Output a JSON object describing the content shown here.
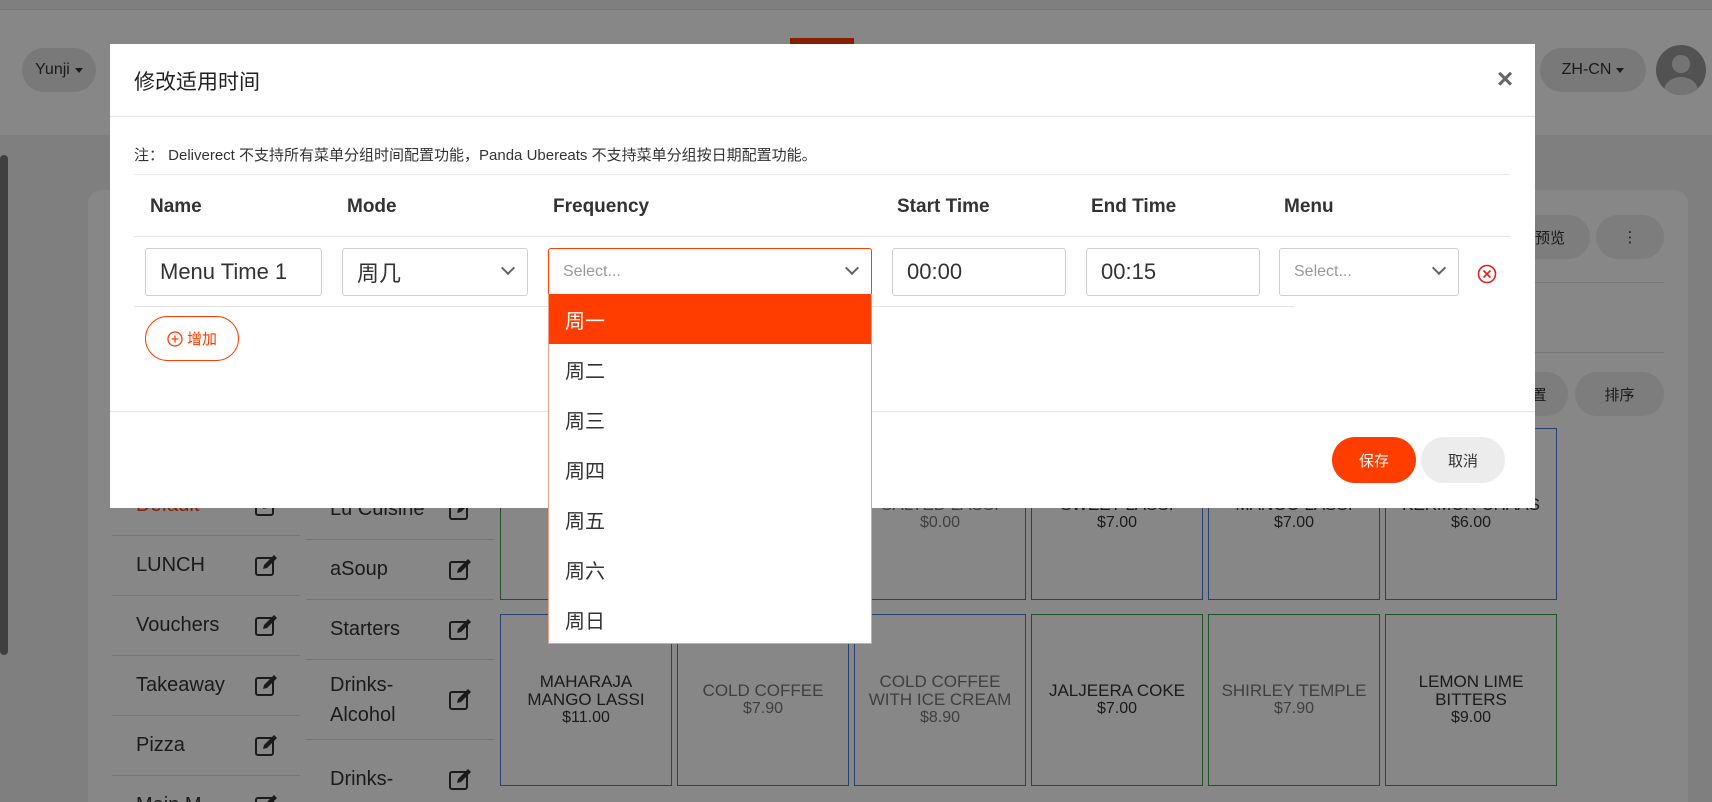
{
  "header": {
    "store_selector": "Yunji",
    "language_selector": "ZH-CN"
  },
  "toolbar": {
    "preview_label": "预览",
    "more_label": "⋮",
    "settings_label": "置",
    "sort_label": "排序"
  },
  "categories": [
    "Default",
    "LUNCH",
    "Vouchers",
    "Takeaway",
    "Pizza",
    "Main M"
  ],
  "subcategories": [
    "Lu Cuisine",
    "aSoup",
    "Starters",
    "Drinks-Alcohol",
    "Drinks-"
  ],
  "products_row1": [
    {
      "name": "",
      "price": ""
    },
    {
      "name": "",
      "price": ""
    },
    {
      "name": "SALTED LASSI",
      "price": "$0.00"
    },
    {
      "name": "SWEET LASSI",
      "price": "$7.00"
    },
    {
      "name": "MANGO LASSI",
      "price": "$7.00"
    },
    {
      "name": "KERMOR CHAAS",
      "price": "$6.00"
    }
  ],
  "products_row2": [
    {
      "name": "MAHARAJA MANGO LASSI",
      "price": "$11.00"
    },
    {
      "name": "COLD COFFEE",
      "price": "$7.90"
    },
    {
      "name": "COLD COFFEE WITH ICE CREAM",
      "price": "$8.90"
    },
    {
      "name": "JALJEERA COKE",
      "price": "$7.00"
    },
    {
      "name": "SHIRLEY TEMPLE",
      "price": "$7.90"
    },
    {
      "name": "LEMON LIME BITTERS",
      "price": "$9.00"
    }
  ],
  "modal": {
    "title": "修改适用时间",
    "close_label": "×",
    "note": "注： Deliverect 不支持所有菜单分组时间配置功能，Panda Ubereats 不支持菜单分组按日期配置功能。",
    "columns": [
      "Name",
      "Mode",
      "Frequency",
      "Start Time",
      "End Time",
      "Menu"
    ],
    "row": {
      "name": "Menu Time 1",
      "mode": "周几",
      "frequency_placeholder": "Select...",
      "start_time": "00:00",
      "end_time": "00:15",
      "menu_placeholder": "Select..."
    },
    "add_label": "增加",
    "save_label": "保存",
    "cancel_label": "取消"
  },
  "frequency_options": [
    "周一",
    "周二",
    "周三",
    "周四",
    "周五",
    "周六",
    "周日"
  ],
  "frequency_highlighted": "周一",
  "colors": {
    "accent": "#ff3d00",
    "tile_border_blue": "#4a78d6",
    "tile_border_green": "#3e9a4e"
  }
}
